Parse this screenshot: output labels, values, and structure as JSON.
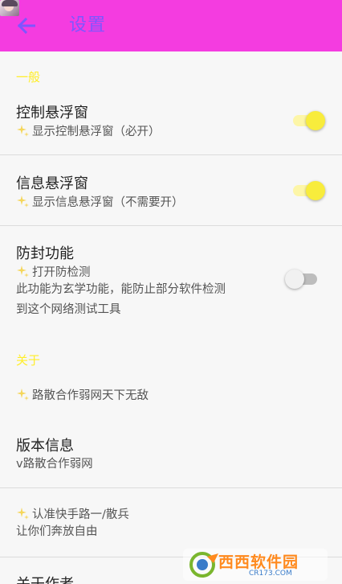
{
  "header": {
    "title": "设置",
    "color": "#f43ce0",
    "title_color": "#7f55ff"
  },
  "sections": {
    "general": "一般",
    "about": "关于"
  },
  "items": {
    "control_window": {
      "title": "控制悬浮窗",
      "subtitle": "显示控制悬浮窗（必开）",
      "enabled": true
    },
    "info_window": {
      "title": "信息悬浮窗",
      "subtitle": "显示信息悬浮窗（不需要开）",
      "enabled": true
    },
    "anti_block": {
      "title": "防封功能",
      "subtitle": "打开防检测",
      "desc_line1": "此功能为玄学功能，能防止部分软件检测",
      "desc_line2": "到这个网络测试工具",
      "enabled": false
    },
    "motto": {
      "subtitle": "路散合作弱网天下无敌"
    },
    "version": {
      "title": "版本信息",
      "value": "v路散合作弱网"
    },
    "kuaishou": {
      "subtitle": "认准快手路一/散兵",
      "desc": "让你们奔放自由"
    },
    "author": {
      "title": "关于作者"
    }
  },
  "watermark": {
    "main": "西西软件园",
    "sub": "CR173.COM"
  },
  "icons": {
    "back": "arrow-left-icon",
    "sparkle": "sparkle-icon"
  }
}
